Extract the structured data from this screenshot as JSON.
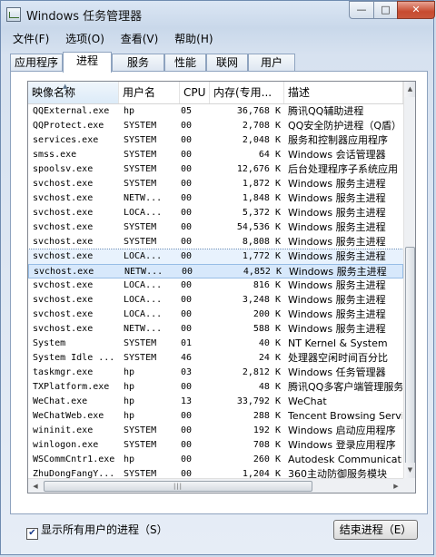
{
  "window": {
    "title": "Windows 任务管理器",
    "min_glyph": "—",
    "max_glyph": "□",
    "close_glyph": "✕"
  },
  "menu": [
    "文件(F)",
    "选项(O)",
    "查看(V)",
    "帮助(H)"
  ],
  "tabs": [
    "应用程序",
    "进程",
    "服务",
    "性能",
    "联网",
    "用户"
  ],
  "active_tab": "进程",
  "columns": [
    "映像名称",
    "用户名",
    "CPU",
    "内存(专用...",
    "描述"
  ],
  "sorted_column": "映像名称",
  "processes": [
    [
      "QQExternal.exe",
      "hp",
      "05",
      "36,768 K",
      "腾讯QQ辅助进程"
    ],
    [
      "QQProtect.exe",
      "SYSTEM",
      "00",
      "2,708 K",
      "QQ安全防护进程（Q盾）"
    ],
    [
      "services.exe",
      "SYSTEM",
      "00",
      "2,048 K",
      "服务和控制器应用程序"
    ],
    [
      "smss.exe",
      "SYSTEM",
      "00",
      "64 K",
      "Windows 会话管理器"
    ],
    [
      "spoolsv.exe",
      "SYSTEM",
      "00",
      "12,676 K",
      "后台处理程序子系统应用"
    ],
    [
      "svchost.exe",
      "SYSTEM",
      "00",
      "1,872 K",
      "Windows 服务主进程"
    ],
    [
      "svchost.exe",
      "NETW...",
      "00",
      "1,848 K",
      "Windows 服务主进程"
    ],
    [
      "svchost.exe",
      "LOCA...",
      "00",
      "5,372 K",
      "Windows 服务主进程"
    ],
    [
      "svchost.exe",
      "SYSTEM",
      "00",
      "54,536 K",
      "Windows 服务主进程"
    ],
    [
      "svchost.exe",
      "SYSTEM",
      "00",
      "8,808 K",
      "Windows 服务主进程"
    ],
    [
      "svchost.exe",
      "LOCA...",
      "00",
      "1,772 K",
      "Windows 服务主进程"
    ],
    [
      "svchost.exe",
      "NETW...",
      "00",
      "4,852 K",
      "Windows 服务主进程"
    ],
    [
      "svchost.exe",
      "LOCA...",
      "00",
      "816 K",
      "Windows 服务主进程"
    ],
    [
      "svchost.exe",
      "LOCA...",
      "00",
      "3,248 K",
      "Windows 服务主进程"
    ],
    [
      "svchost.exe",
      "LOCA...",
      "00",
      "200 K",
      "Windows 服务主进程"
    ],
    [
      "svchost.exe",
      "NETW...",
      "00",
      "588 K",
      "Windows 服务主进程"
    ],
    [
      "System",
      "SYSTEM",
      "01",
      "40 K",
      "NT Kernel & System"
    ],
    [
      "System Idle ...",
      "SYSTEM",
      "46",
      "24 K",
      "处理器空闲时间百分比"
    ],
    [
      "taskmgr.exe",
      "hp",
      "03",
      "2,812 K",
      "Windows 任务管理器"
    ],
    [
      "TXPlatform.exe",
      "hp",
      "00",
      "48 K",
      "腾讯QQ多客户端管理服务"
    ],
    [
      "WeChat.exe",
      "hp",
      "13",
      "33,792 K",
      "WeChat"
    ],
    [
      "WeChatWeb.exe",
      "hp",
      "00",
      "288 K",
      "Tencent Browsing Service"
    ],
    [
      "wininit.exe",
      "SYSTEM",
      "00",
      "192 K",
      "Windows 启动应用程序"
    ],
    [
      "winlogon.exe",
      "SYSTEM",
      "00",
      "708 K",
      "Windows 登录应用程序"
    ],
    [
      "WSCommCntr1.exe",
      "hp",
      "00",
      "260 K",
      "Autodesk Communication"
    ],
    [
      "ZhuDongFangY...",
      "SYSTEM",
      "00",
      "1,204 K",
      "360主动防御服务模块"
    ]
  ],
  "selected_row": 10,
  "hover_row": 11,
  "show_all_users": {
    "label": "显示所有用户的进程（S）",
    "checked": true
  },
  "end_process_label": "结束进程（E）",
  "scroll": {
    "vertical_position": 0.42,
    "vertical_thumb_fraction": 0.6,
    "hscroll_glyph": "|||"
  }
}
